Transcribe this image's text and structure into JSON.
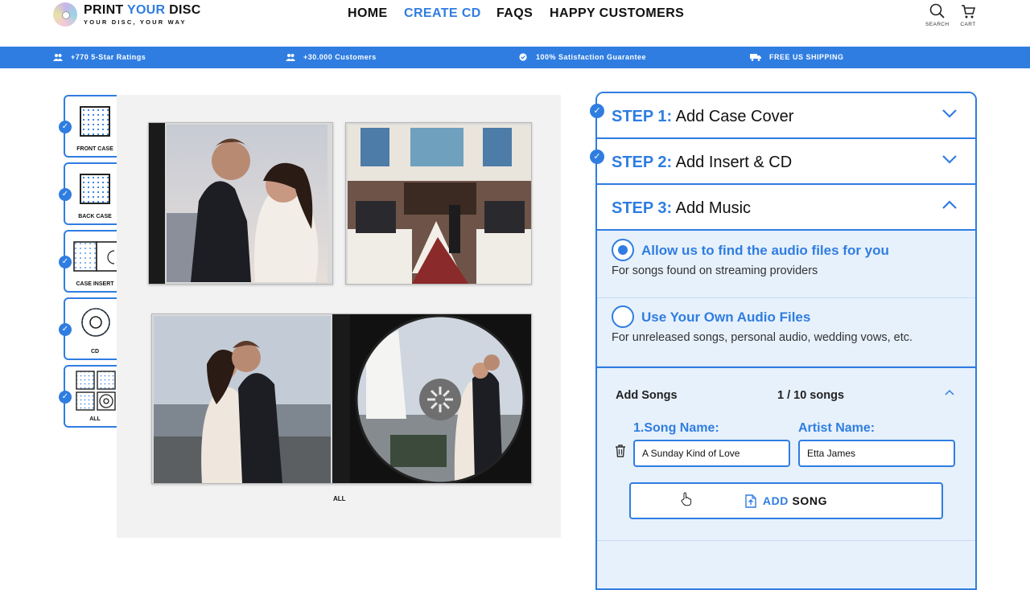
{
  "brand": {
    "title_a": "PRINT ",
    "title_b": "YOUR",
    "title_c": " DISC",
    "tagline": "YOUR DISC, YOUR WAY",
    "accent": "#2f7de1"
  },
  "nav": {
    "home": "HOME",
    "create_cd": "CREATE CD",
    "faqs": "FAQS",
    "happy_customers": "HAPPY CUSTOMERS"
  },
  "header_icons": {
    "search": "SEARCH",
    "cart": "CART"
  },
  "trust": [
    {
      "text": "+770 5-Star Ratings",
      "icon": "people-icon"
    },
    {
      "text": "+30.000 Customers",
      "icon": "people-icon"
    },
    {
      "text": "100% Satisfaction Guarantee",
      "icon": "check-badge-icon"
    },
    {
      "text": "FREE US SHIPPING",
      "icon": "truck-icon"
    }
  ],
  "thumbnails": [
    {
      "label": "FRONT CASE"
    },
    {
      "label": "BACK CASE"
    },
    {
      "label": "CASE INSERT"
    },
    {
      "label": "CD"
    },
    {
      "label": "ALL"
    }
  ],
  "preview": {
    "label": "ALL"
  },
  "steps": [
    {
      "prefix": "STEP 1:",
      "title": " Add Case Cover",
      "expanded": false
    },
    {
      "prefix": "STEP 2:",
      "title": " Add Insert & CD",
      "expanded": false
    },
    {
      "prefix": "STEP 3:",
      "title": " Add Music",
      "expanded": true
    }
  ],
  "music_options": [
    {
      "title": "Allow us to find the audio files for you",
      "subtitle": "For songs found on streaming providers",
      "selected": true
    },
    {
      "title": "Use Your Own Audio Files",
      "subtitle": "For unreleased songs, personal audio, wedding vows, etc.",
      "selected": false
    }
  ],
  "songs": {
    "header": "Add Songs",
    "count": "1 / 10 songs",
    "song_name_label": "1.Song Name:",
    "artist_name_label": "Artist Name:",
    "song_name_value": "A Sunday Kind of Love",
    "artist_name_value": "Etta James",
    "add_prefix": "ADD",
    "add_suffix": " SONG"
  }
}
